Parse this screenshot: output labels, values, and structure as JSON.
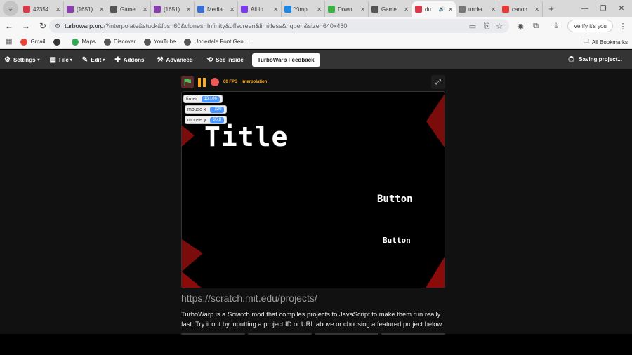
{
  "browser": {
    "tabs": [
      {
        "label": "42354",
        "color": "#d93a4b"
      },
      {
        "label": "(1651)",
        "color": "#8b3fae"
      },
      {
        "label": "Game",
        "color": "#555555"
      },
      {
        "label": "(1651)",
        "color": "#8b3fae"
      },
      {
        "label": "Media",
        "color": "#3a6fd9"
      },
      {
        "label": "All In",
        "color": "#7c3aed"
      },
      {
        "label": "Ytmp",
        "color": "#1e88e5"
      },
      {
        "label": "Down",
        "color": "#3cb043"
      },
      {
        "label": "Game",
        "color": "#555555"
      },
      {
        "label": "du",
        "color": "#d93a4b",
        "active": true
      },
      {
        "label": "under",
        "color": "#777777"
      },
      {
        "label": "canon",
        "color": "#e53935"
      }
    ],
    "url_host": "turbowarp.org",
    "url_rest": "/?interpolate&stuck&fps=60&clones=Infinity&offscreen&limitless&hqpen&size=640x480",
    "verify_label": "Verify it's you",
    "bookmarks": [
      {
        "label": "Gmail",
        "color": "#ea4335"
      },
      {
        "label": "",
        "color": "#333333"
      },
      {
        "label": "Maps",
        "color": "#34a853"
      },
      {
        "label": "Discover",
        "color": "#555555"
      },
      {
        "label": "YouTube",
        "color": "#555555"
      },
      {
        "label": "Undertale Font Gen...",
        "color": "#555555"
      }
    ],
    "all_bookmarks": "All Bookmarks"
  },
  "menubar": {
    "settings": "Settings",
    "file": "File",
    "edit": "Edit",
    "addons": "Addons",
    "advanced": "Advanced",
    "see_inside": "See inside",
    "feedback": "TurboWarp Feedback",
    "status": "Saving project..."
  },
  "controls": {
    "fps": "60 FPS",
    "interpolation": "Interpolation"
  },
  "monitors": [
    {
      "label": "timer",
      "value": "13.106"
    },
    {
      "label": "mouse x",
      "value": "-320"
    },
    {
      "label": "mouse y",
      "value": "35.8"
    }
  ],
  "game": {
    "title": "Title",
    "button1": "Button",
    "button2": "Button"
  },
  "project_url_placeholder": "https://scratch.mit.edu/projects/",
  "description": "TurboWarp is a Scratch mod that compiles projects to JavaScript to make them run really fast. Try it out by inputting a project ID or URL above or choosing a featured project below.",
  "colors": {
    "stage_corner": "#8b0a0a",
    "menubar_bg": "#343434",
    "monitor_value": "#4c97ff",
    "controls_accent": "#ffab19"
  }
}
